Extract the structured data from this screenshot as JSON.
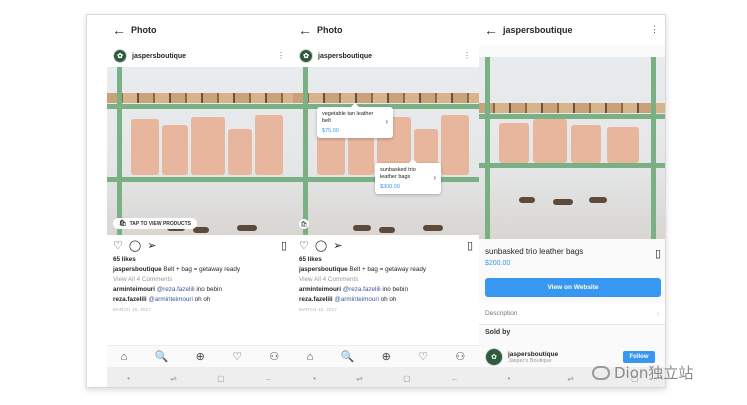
{
  "panel1": {
    "header_title": "Photo",
    "username": "jaspersboutique",
    "tap_tag": "TAP TO VIEW PRODUCTS",
    "likes": "65 likes",
    "caption_user": "jaspersboutique",
    "caption_text": "Belt + bag = getaway ready",
    "view_comments": "View All 4 Comments",
    "comment1_user": "arminteimouri",
    "comment1_mention": "@reza.fazelili",
    "comment1_text": "ino bebin",
    "comment2_user": "reza.fazelili",
    "comment2_mention": "@arminteimouri",
    "comment2_text": "oh oh",
    "date": "MARCH 15, 2017"
  },
  "panel2": {
    "header_title": "Photo",
    "username": "jaspersboutique",
    "tag1_name": "vegetable tan leather belt",
    "tag1_price": "$75.00",
    "tag2_name": "sunbasked trio leather bags",
    "tag2_price": "$300.00",
    "likes": "65 likes",
    "caption_user": "jaspersboutique",
    "caption_text": "Belt + bag = getaway ready",
    "view_comments": "View All 4 Comments",
    "comment1_user": "arminteimouri",
    "comment1_mention": "@reza.fazelili",
    "comment1_text": "ino bebin",
    "comment2_user": "reza.fazelili",
    "comment2_mention": "@arminteimouri",
    "comment2_text": "oh oh",
    "date": "MARCH 15, 2017"
  },
  "panel3": {
    "header_title": "jaspersboutique",
    "product_name": "sunbasked trio leather bags",
    "product_price": "$200.00",
    "view_website": "View on Website",
    "description_label": "Description",
    "sold_by_label": "Sold by",
    "seller_name": "jaspersboutique",
    "seller_sub": "Jasper's Boutique",
    "follow_label": "Follow"
  },
  "icons": {
    "back": "←",
    "more": "⋮",
    "heart": "♡",
    "comment": "◯",
    "share": "➢",
    "bookmark": "▯",
    "home": "⌂",
    "search": "🔍",
    "add": "⊕",
    "activity": "♡",
    "profile": "⚇",
    "sys_dot": "•",
    "sys_recent": "⇌",
    "sys_home": "▢",
    "sys_back": "←",
    "chevron": "›",
    "shopping_bag": "🛍"
  },
  "watermark_text": "Dion独立站",
  "colors": {
    "accent": "#3897f0",
    "shelf_green": "#7bb085",
    "bag_tan": "#e8b69c"
  }
}
